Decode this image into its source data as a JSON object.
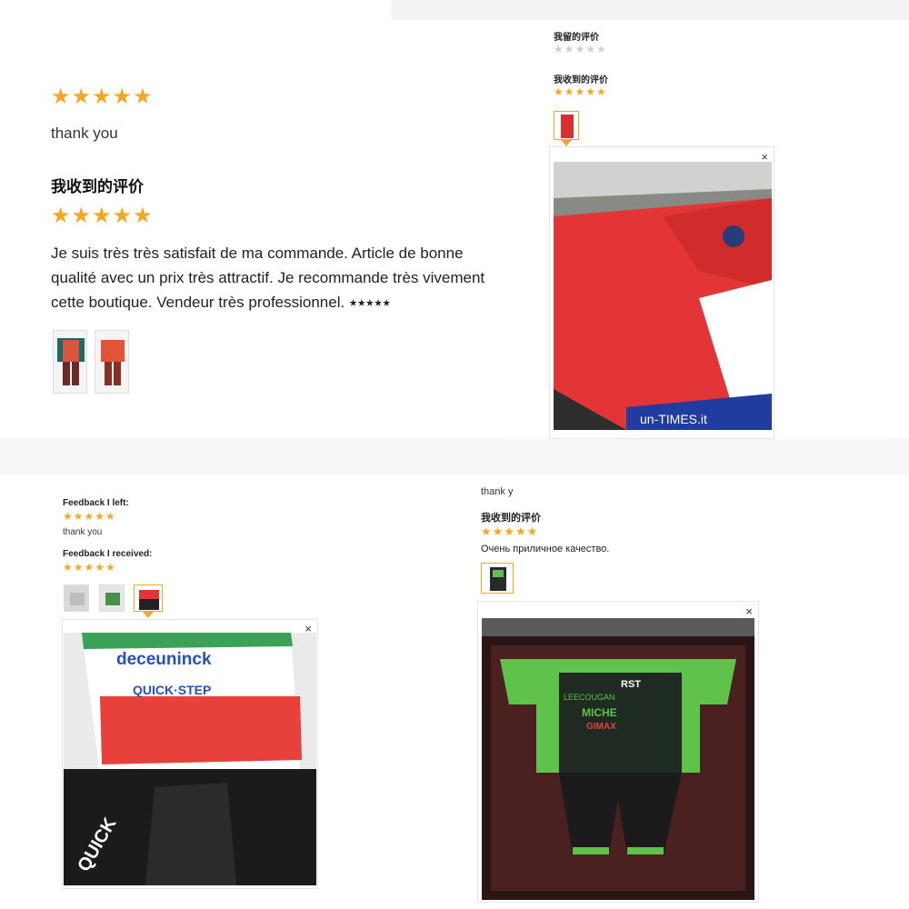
{
  "panel_a": {
    "stars_top": "★★★★★",
    "comment_top": "thank you",
    "received_heading": "我收到的评价",
    "stars_received": "★★★★★",
    "comment_received": "Je suis très très satisfait de ma commande. Article de bonne qualité avec un prix très attractif. Je recommande très vivement cette boutique. Vendeur très professionnel. ⭑⭑⭑⭑⭑",
    "thumb_count": 2
  },
  "panel_b": {
    "left_heading": "我留的评价",
    "stars_left": "★★★★★",
    "received_heading": "我收到的评价",
    "stars_received": "★★★★★",
    "close_label": "×",
    "photo_text": "un-TIMES.it"
  },
  "panel_c": {
    "left_heading": "Feedback I left:",
    "stars_left": "★★★★★",
    "comment_left": "thank you",
    "received_heading": "Feedback I received:",
    "stars_received": "★★★★★",
    "close_label": "×",
    "jersey_brand": "deceuninck",
    "jersey_sub": "QUICK·STEP",
    "shorts_text": "QUICK"
  },
  "panel_d": {
    "comment_top": "thank y",
    "received_heading": "我收到的评价",
    "stars_received": "★★★★★",
    "comment_received": "Очень приличное качество.",
    "close_label": "×",
    "jersey_rst": "RST",
    "jersey_brand": "LEECOUGAN",
    "jersey_miche": "MICHE",
    "jersey_gimax": "GIMAX"
  },
  "colors": {
    "star": "#f5a623",
    "star_empty": "#cfcfcf",
    "accent_border": "#f5a623"
  }
}
